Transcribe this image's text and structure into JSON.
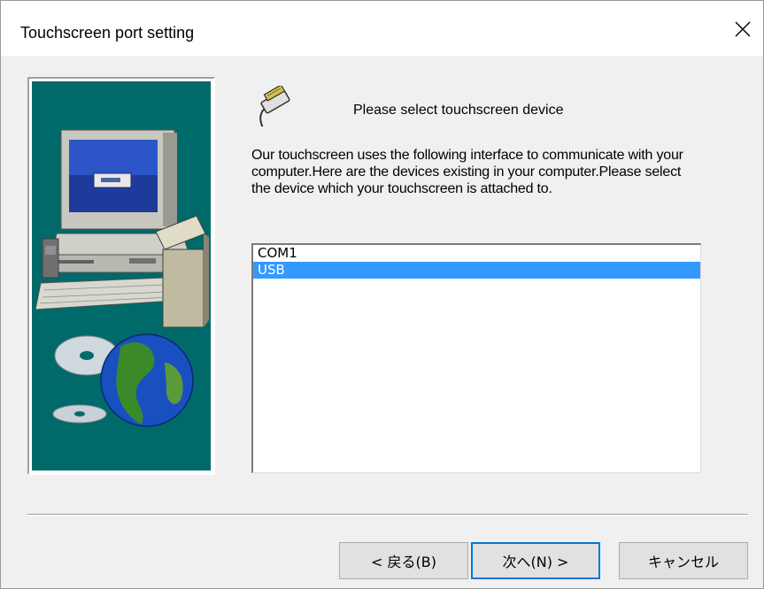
{
  "window": {
    "title": "Touchscreen port setting",
    "close_label": "close"
  },
  "header": {
    "icon": "serial-connector-icon",
    "text": "Please select touchscreen device"
  },
  "description": "Our touchscreen uses the following interface to communicate with your computer.Here are the devices existing in your computer.Please select the device which your touchscreen is attached to.",
  "device_list": {
    "items": [
      {
        "label": "COM1",
        "selected": false
      },
      {
        "label": "USB",
        "selected": true
      }
    ],
    "selection_color": "#3399ff"
  },
  "buttons": {
    "back_label": "< 戻る(B)",
    "next_label": "次へ(N) >",
    "cancel_label": "キャンセル"
  },
  "colors": {
    "wizard_panel_bg": "#006a6a",
    "default_button_border": "#0078d7"
  }
}
